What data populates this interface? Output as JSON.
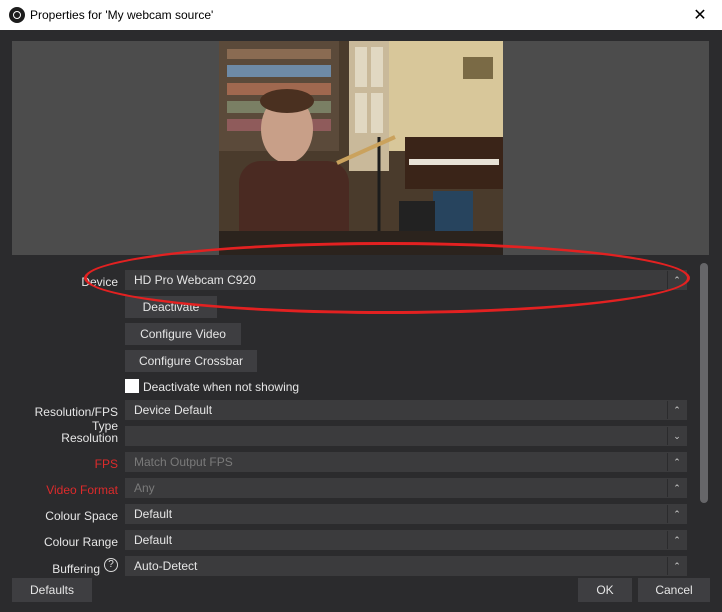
{
  "window": {
    "title": "Properties for 'My webcam source'",
    "close_glyph": "✕",
    "icon": "obs-icon"
  },
  "properties": {
    "device": {
      "label": "Device",
      "value": "HD Pro Webcam C920"
    },
    "deactivate_button": "Deactivate",
    "configure_video_button": "Configure Video",
    "configure_crossbar_button": "Configure Crossbar",
    "deactivate_when_not_showing": {
      "label": "Deactivate when not showing",
      "checked": false
    },
    "resolution_fps_type": {
      "label": "Resolution/FPS Type",
      "value": "Device Default"
    },
    "resolution": {
      "label": "Resolution",
      "value": ""
    },
    "fps": {
      "label": "FPS",
      "value": "Match Output FPS"
    },
    "video_format": {
      "label": "Video Format",
      "value": "Any"
    },
    "colour_space": {
      "label": "Colour Space",
      "value": "Default"
    },
    "colour_range": {
      "label": "Colour Range",
      "value": "Default"
    },
    "buffering": {
      "label": "Buffering",
      "value": "Auto-Detect",
      "help_glyph": "?"
    }
  },
  "footer": {
    "defaults_button": "Defaults",
    "ok_button": "OK",
    "cancel_button": "Cancel"
  },
  "colors": {
    "background": "#2b2b2d",
    "field": "#3b3b3d",
    "warning_label": "#dd2b2b",
    "highlight_ellipse": "#e32121"
  }
}
